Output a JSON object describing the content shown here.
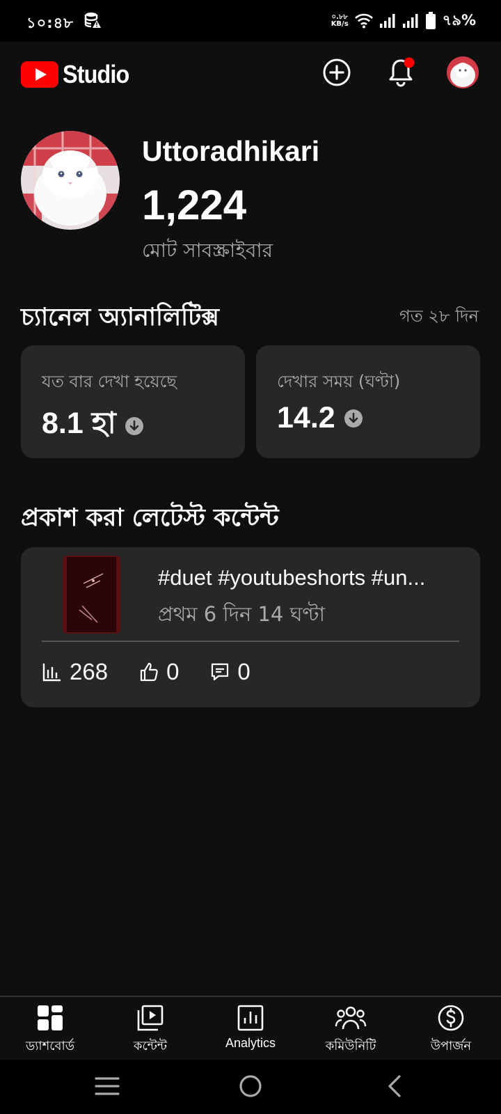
{
  "status_bar": {
    "time": "১০:৪৮",
    "net_speed_value": "০.৮৮",
    "net_speed_unit": "KB/s",
    "battery": "৭৯%"
  },
  "header": {
    "logo_text": "Studio",
    "icons": [
      "add-circle-icon",
      "bell-icon",
      "avatar"
    ]
  },
  "profile": {
    "channel_name": "Uttoradhikari",
    "subscriber_count": "1,224",
    "subscriber_label": "মোট সাবস্ক্রাইবার"
  },
  "analytics": {
    "title": "চ্যানেল অ্যানালিটিক্স",
    "period": "গত ২৮ দিন",
    "cards": [
      {
        "label": "যত বার দেখা হয়েছে",
        "value": "8.1 হা",
        "trend": "down"
      },
      {
        "label": "দেখার সময় (ঘণ্টা)",
        "value": "14.2",
        "trend": "down"
      }
    ]
  },
  "latest": {
    "title": "প্রকাশ করা লেটেস্ট কন্টেন্ট",
    "video_title": "#duet #youtubeshorts #un...",
    "video_age": "প্রথম 6 দিন 14 ঘণ্টা",
    "views": "268",
    "likes": "0",
    "comments": "0"
  },
  "nav": {
    "items": [
      {
        "label": "ড্যাশবোর্ড",
        "icon": "dashboard-icon",
        "active": true
      },
      {
        "label": "কন্টেন্ট",
        "icon": "content-icon"
      },
      {
        "label": "Analytics",
        "icon": "analytics-icon"
      },
      {
        "label": "কমিউনিটি",
        "icon": "community-icon"
      },
      {
        "label": "উপার্জন",
        "icon": "earn-icon"
      }
    ]
  },
  "colors": {
    "background": "#0f0f0f",
    "card": "#272727",
    "youtube_red": "#ff0000",
    "secondary_text": "#aaaaaa"
  }
}
